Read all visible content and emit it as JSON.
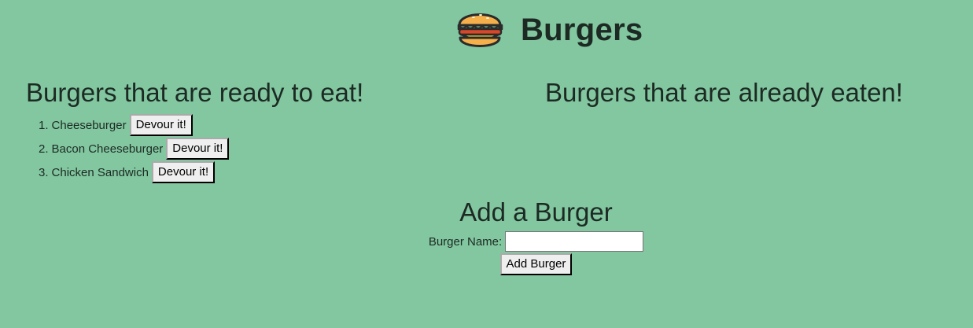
{
  "app": {
    "title": "Burgers",
    "logo_icon": "hamburger-icon"
  },
  "ready": {
    "heading": "Burgers that are ready to eat!",
    "items": [
      {
        "number": "1.",
        "name": "Cheeseburger",
        "button": "Devour it!"
      },
      {
        "number": "2.",
        "name": "Bacon Cheeseburger",
        "button": "Devour it!"
      },
      {
        "number": "3.",
        "name": "Chicken Sandwich",
        "button": "Devour it!"
      }
    ]
  },
  "eaten": {
    "heading": "Burgers that are already eaten!",
    "items": []
  },
  "add_form": {
    "heading": "Add a Burger",
    "label": "Burger Name:",
    "value": "",
    "placeholder": "",
    "submit": "Add Burger"
  },
  "colors": {
    "background": "#82c7a0",
    "text": "#1d2a24"
  }
}
